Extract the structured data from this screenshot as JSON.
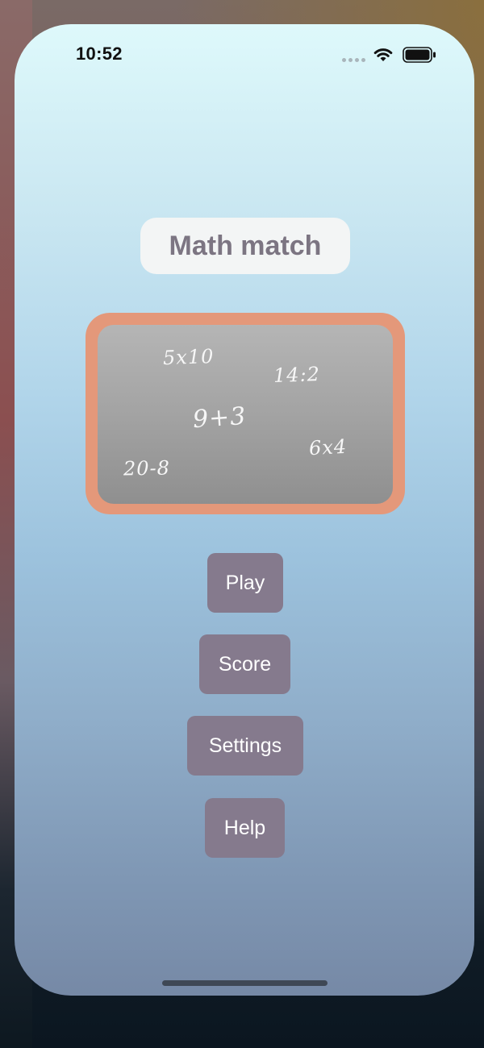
{
  "status_bar": {
    "time": "10:52",
    "icons": [
      "signal-dots-icon",
      "wifi-icon",
      "battery-icon"
    ]
  },
  "app": {
    "title": "Math match"
  },
  "chalkboard": {
    "expressions": [
      "5x10",
      "14:2",
      "9+3",
      "6x4",
      "20-8"
    ]
  },
  "menu": {
    "play_label": "Play",
    "score_label": "Score",
    "settings_label": "Settings",
    "help_label": "Help"
  },
  "colors": {
    "button_bg": "#857a8d",
    "title_text": "#7c7582",
    "board_frame": "#e4987a",
    "board_bg": "#a3a3a3"
  }
}
